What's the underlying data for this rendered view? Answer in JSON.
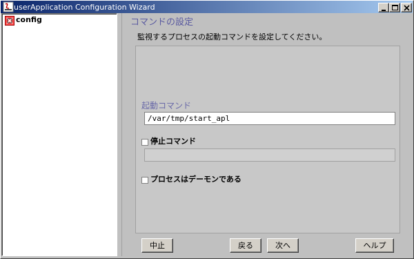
{
  "window": {
    "title": "userApplication Configuration Wizard",
    "controls": [
      "minimize",
      "maximize",
      "close"
    ]
  },
  "tree": {
    "items": [
      {
        "label": "config",
        "icon": "config-node-icon"
      }
    ]
  },
  "page": {
    "section_title": "コマンドの設定",
    "description": "監視するプロセスの起動コマンドを設定してください。",
    "start_command": {
      "label": "起動コマンド",
      "value": "/var/tmp/start_apl"
    },
    "stop_command": {
      "label": "停止コマンド",
      "checked": false,
      "value": ""
    },
    "daemon_option": {
      "label": "プロセスはデーモンである",
      "checked": false
    }
  },
  "buttons": {
    "cancel": "中止",
    "back": "戻る",
    "next": "次へ",
    "help": "ヘルプ"
  },
  "colors": {
    "titlebar_start": "#0a246a",
    "titlebar_end": "#a6caf0",
    "section_title": "#5a5aa0",
    "panel_bg": "#c0c0c0"
  }
}
